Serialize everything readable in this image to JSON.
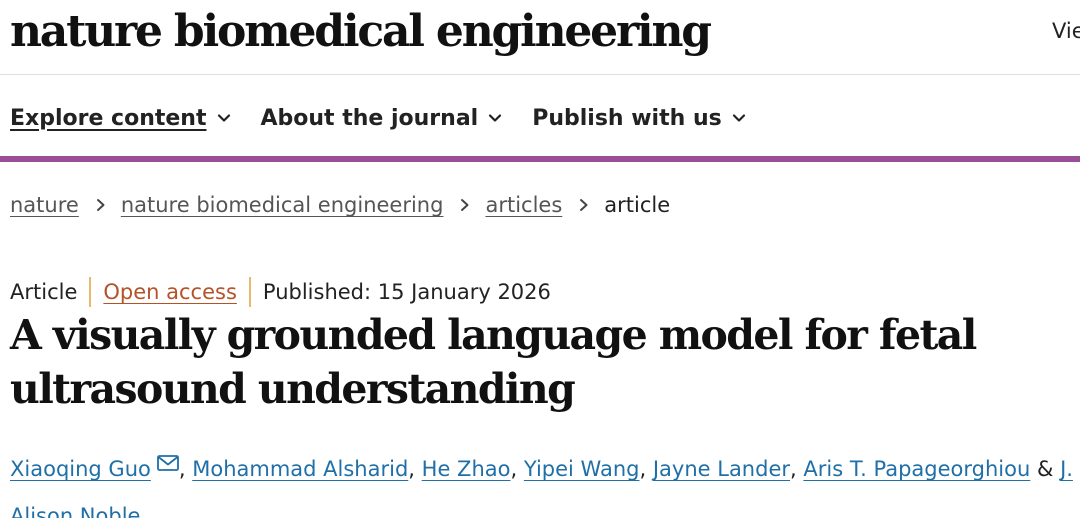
{
  "header": {
    "journal_name": "nature biomedical engineering",
    "view_cut": "Vie"
  },
  "nav": {
    "items": [
      {
        "label": "Explore content",
        "active": true
      },
      {
        "label": "About the journal",
        "active": false
      },
      {
        "label": "Publish with us",
        "active": false
      }
    ]
  },
  "breadcrumb": {
    "items": [
      "nature",
      "nature biomedical engineering",
      "articles"
    ],
    "current": "article"
  },
  "article": {
    "type": "Article",
    "access": "Open access",
    "published": "Published: 15 January 2026",
    "title": "A visually grounded language model for fetal ultrasound understanding",
    "authors": [
      "Xiaoqing Guo",
      "Mohammad Alsharid",
      "He Zhao",
      "Yipei Wang",
      "Jayne Lander",
      "Aris T. Papageorghiou",
      "J. Alison Noble"
    ],
    "author_separator": ",",
    "last_joiner": "&"
  },
  "colors": {
    "accent_bar": "#9a4e96",
    "open_access": "#b4532a",
    "link": "#1f6fa8",
    "divider": "#e8b86c"
  },
  "icons": {
    "chevron": "chevron-down-icon",
    "separator": "chevron-right-icon",
    "mail": "mail-icon"
  }
}
